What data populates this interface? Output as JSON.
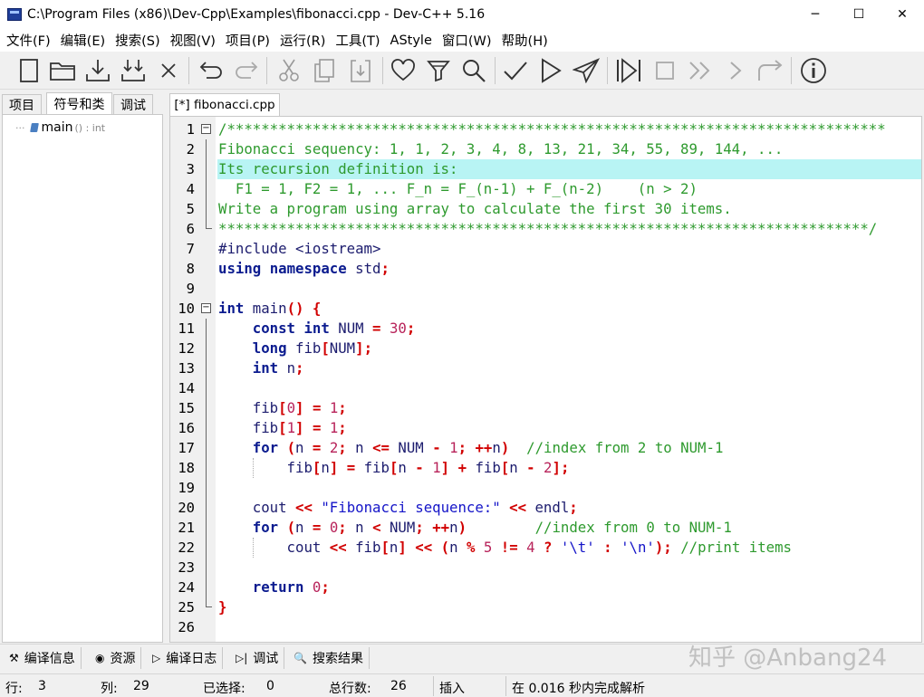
{
  "window": {
    "title": "C:\\Program Files (x86)\\Dev-Cpp\\Examples\\fibonacci.cpp - Dev-C++ 5.16",
    "minimize_glyph": "─",
    "maximize_glyph": "☐",
    "close_glyph": "✕"
  },
  "menu": [
    "文件(F)",
    "编辑(E)",
    "搜索(S)",
    "视图(V)",
    "项目(P)",
    "运行(R)",
    "工具(T)",
    "AStyle",
    "窗口(W)",
    "帮助(H)"
  ],
  "toolbar_icons": [
    "new-file-icon",
    "open-folder-icon",
    "save-icon",
    "save-all-icon",
    "close-file-icon",
    "undo-icon",
    "redo-icon",
    "cut-icon",
    "copy-icon",
    "paste-icon",
    "heart-icon",
    "filter-icon",
    "search-icon",
    "check-icon",
    "run-icon",
    "send-icon",
    "step-icon",
    "stop-icon",
    "fast-forward-icon",
    "next-icon",
    "redirect-icon",
    "info-icon"
  ],
  "left_tabs": [
    "项目",
    "符号和类",
    "调试"
  ],
  "class_tree": {
    "name": "main",
    "signature": "() : int"
  },
  "file_tab": "[*] fibonacci.cpp",
  "code_lines": [
    [
      [
        "comment",
        "/*****************************************************************************"
      ]
    ],
    [
      [
        "comment",
        "Fibonacci sequency: 1, 1, 2, 3, 4, 8, 13, 21, 34, 55, 89, 144, ..."
      ]
    ],
    [
      [
        "comment",
        "Its recursion definition is:"
      ]
    ],
    [
      [
        "comment",
        "  F1 = 1, F2 = 1, ... F_n = F_(n-1) + F_(n-2)    (n > 2)"
      ]
    ],
    [
      [
        "comment",
        "Write a program using array to calculate the first 30 items."
      ]
    ],
    [
      [
        "comment",
        "****************************************************************************/"
      ]
    ],
    [
      [
        "pre",
        "#include <iostream>"
      ]
    ],
    [
      [
        "kw",
        "using"
      ],
      [
        "plain",
        " "
      ],
      [
        "kw",
        "namespace"
      ],
      [
        "plain",
        " std"
      ],
      [
        "op",
        ";"
      ]
    ],
    [],
    [
      [
        "kw",
        "int"
      ],
      [
        "plain",
        " main"
      ],
      [
        "op",
        "()"
      ],
      [
        "plain",
        " "
      ],
      [
        "op",
        "{"
      ]
    ],
    [
      [
        "plain",
        "    "
      ],
      [
        "kw",
        "const"
      ],
      [
        "plain",
        " "
      ],
      [
        "kw",
        "int"
      ],
      [
        "plain",
        " NUM "
      ],
      [
        "op",
        "="
      ],
      [
        "plain",
        " "
      ],
      [
        "num",
        "30"
      ],
      [
        "op",
        ";"
      ]
    ],
    [
      [
        "plain",
        "    "
      ],
      [
        "kw",
        "long"
      ],
      [
        "plain",
        " fib"
      ],
      [
        "op",
        "["
      ],
      [
        "plain",
        "NUM"
      ],
      [
        "op",
        "];"
      ]
    ],
    [
      [
        "plain",
        "    "
      ],
      [
        "kw",
        "int"
      ],
      [
        "plain",
        " n"
      ],
      [
        "op",
        ";"
      ]
    ],
    [],
    [
      [
        "plain",
        "    fib"
      ],
      [
        "op",
        "["
      ],
      [
        "num",
        "0"
      ],
      [
        "op",
        "]"
      ],
      [
        "plain",
        " "
      ],
      [
        "op",
        "="
      ],
      [
        "plain",
        " "
      ],
      [
        "num",
        "1"
      ],
      [
        "op",
        ";"
      ]
    ],
    [
      [
        "plain",
        "    fib"
      ],
      [
        "op",
        "["
      ],
      [
        "num",
        "1"
      ],
      [
        "op",
        "]"
      ],
      [
        "plain",
        " "
      ],
      [
        "op",
        "="
      ],
      [
        "plain",
        " "
      ],
      [
        "num",
        "1"
      ],
      [
        "op",
        ";"
      ]
    ],
    [
      [
        "plain",
        "    "
      ],
      [
        "kw",
        "for"
      ],
      [
        "plain",
        " "
      ],
      [
        "op",
        "("
      ],
      [
        "plain",
        "n "
      ],
      [
        "op",
        "="
      ],
      [
        "plain",
        " "
      ],
      [
        "num",
        "2"
      ],
      [
        "op",
        ";"
      ],
      [
        "plain",
        " n "
      ],
      [
        "op",
        "<="
      ],
      [
        "plain",
        " NUM "
      ],
      [
        "op",
        "-"
      ],
      [
        "plain",
        " "
      ],
      [
        "num",
        "1"
      ],
      [
        "op",
        ";"
      ],
      [
        "plain",
        " "
      ],
      [
        "op",
        "++"
      ],
      [
        "plain",
        "n"
      ],
      [
        "op",
        ")"
      ],
      [
        "plain",
        "  "
      ],
      [
        "comment",
        "//index from 2 to NUM-1"
      ]
    ],
    [
      [
        "plain",
        "        fib"
      ],
      [
        "op",
        "["
      ],
      [
        "plain",
        "n"
      ],
      [
        "op",
        "]"
      ],
      [
        "plain",
        " "
      ],
      [
        "op",
        "="
      ],
      [
        "plain",
        " fib"
      ],
      [
        "op",
        "["
      ],
      [
        "plain",
        "n "
      ],
      [
        "op",
        "-"
      ],
      [
        "plain",
        " "
      ],
      [
        "num",
        "1"
      ],
      [
        "op",
        "]"
      ],
      [
        "plain",
        " "
      ],
      [
        "op",
        "+"
      ],
      [
        "plain",
        " fib"
      ],
      [
        "op",
        "["
      ],
      [
        "plain",
        "n "
      ],
      [
        "op",
        "-"
      ],
      [
        "plain",
        " "
      ],
      [
        "num",
        "2"
      ],
      [
        "op",
        "];"
      ]
    ],
    [],
    [
      [
        "plain",
        "    cout "
      ],
      [
        "op",
        "<<"
      ],
      [
        "plain",
        " "
      ],
      [
        "str",
        "\"Fibonacci sequence:\""
      ],
      [
        "plain",
        " "
      ],
      [
        "op",
        "<<"
      ],
      [
        "plain",
        " endl"
      ],
      [
        "op",
        ";"
      ]
    ],
    [
      [
        "plain",
        "    "
      ],
      [
        "kw",
        "for"
      ],
      [
        "plain",
        " "
      ],
      [
        "op",
        "("
      ],
      [
        "plain",
        "n "
      ],
      [
        "op",
        "="
      ],
      [
        "plain",
        " "
      ],
      [
        "num",
        "0"
      ],
      [
        "op",
        ";"
      ],
      [
        "plain",
        " n "
      ],
      [
        "op",
        "<"
      ],
      [
        "plain",
        " NUM"
      ],
      [
        "op",
        ";"
      ],
      [
        "plain",
        " "
      ],
      [
        "op",
        "++"
      ],
      [
        "plain",
        "n"
      ],
      [
        "op",
        ")"
      ],
      [
        "plain",
        "        "
      ],
      [
        "comment",
        "//index from 0 to NUM-1"
      ]
    ],
    [
      [
        "plain",
        "        cout "
      ],
      [
        "op",
        "<<"
      ],
      [
        "plain",
        " fib"
      ],
      [
        "op",
        "["
      ],
      [
        "plain",
        "n"
      ],
      [
        "op",
        "]"
      ],
      [
        "plain",
        " "
      ],
      [
        "op",
        "<<"
      ],
      [
        "plain",
        " "
      ],
      [
        "op",
        "("
      ],
      [
        "plain",
        "n "
      ],
      [
        "op",
        "%"
      ],
      [
        "plain",
        " "
      ],
      [
        "num",
        "5"
      ],
      [
        "plain",
        " "
      ],
      [
        "op",
        "!="
      ],
      [
        "plain",
        " "
      ],
      [
        "num",
        "4"
      ],
      [
        "plain",
        " "
      ],
      [
        "op",
        "?"
      ],
      [
        "plain",
        " "
      ],
      [
        "chr",
        "'\\t'"
      ],
      [
        "plain",
        " "
      ],
      [
        "op",
        ":"
      ],
      [
        "plain",
        " "
      ],
      [
        "chr",
        "'\\n'"
      ],
      [
        "op",
        ");"
      ],
      [
        "plain",
        " "
      ],
      [
        "comment",
        "//print items"
      ]
    ],
    [],
    [
      [
        "plain",
        "    "
      ],
      [
        "kw",
        "return"
      ],
      [
        "plain",
        " "
      ],
      [
        "num",
        "0"
      ],
      [
        "op",
        ";"
      ]
    ],
    [
      [
        "op",
        "}"
      ]
    ],
    []
  ],
  "highlighted_line": 3,
  "bottom_tabs": [
    {
      "icon": "⚒",
      "label": "编译信息"
    },
    {
      "icon": "◉",
      "label": "资源"
    },
    {
      "icon": "▷",
      "label": "编译日志"
    },
    {
      "icon": "▷|",
      "label": "调试"
    },
    {
      "icon": "🔍",
      "label": "搜索结果"
    }
  ],
  "watermark": "知乎 @Anbang24",
  "status": {
    "row_label": "行:",
    "row_value": "3",
    "col_label": "列:",
    "col_value": "29",
    "sel_label": "已选择:",
    "sel_value": "0",
    "total_label": "总行数:",
    "total_value": "26",
    "mode": "插入",
    "parse_msg": "在 0.016 秒内完成解析"
  }
}
